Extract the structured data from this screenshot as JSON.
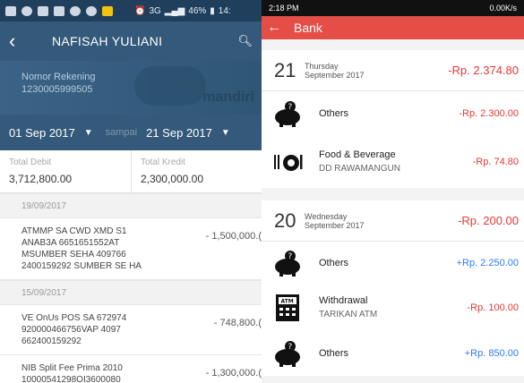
{
  "left": {
    "statusbar": {
      "signal": "3G",
      "battery": "46%",
      "time": "14:"
    },
    "header": {
      "title": "NAFISAH YULIANI"
    },
    "account": {
      "label": "Nomor Rekening",
      "number": "1230005999505",
      "watermark": "mandiri"
    },
    "date_range": {
      "from": "01 Sep 2017",
      "separator": "sampai",
      "to": "21 Sep 2017"
    },
    "totals": {
      "debit_label": "Total Debit",
      "debit_value": "3,712,800.00",
      "credit_label": "Total Kredit",
      "credit_value": "2,300,000.00"
    },
    "groups": [
      {
        "date": "19/09/2017",
        "items": [
          {
            "desc": "ATMMP SA CWD XMD S1 ANAB3A 6651651552AT MSUMBER SEHA 409766 2400159292 SUMBER SE HA",
            "amount": "- 1,500,000.("
          }
        ]
      },
      {
        "date": "15/09/2017",
        "items": [
          {
            "desc": "VE OnUs POS SA 672974 920000466756VAP 4097 662400159292",
            "amount": "- 748,800.("
          },
          {
            "desc": "NIB Split Fee Prima 2010 10000541298OI3600080",
            "amount": "- 1,300,000.("
          }
        ]
      }
    ]
  },
  "right": {
    "statusbar": {
      "time": "2:18 PM",
      "speed": "0.00K/s"
    },
    "header": {
      "title": "Bank"
    },
    "days": [
      {
        "day": "21",
        "weekday": "Thursday",
        "month": "September 2017",
        "total": "-Rp. 2.374.80",
        "items": [
          {
            "icon": "piggy-bank-question-icon",
            "label": "Others",
            "sub": "",
            "amount": "-Rp. 2.300.00",
            "sign": "neg"
          },
          {
            "icon": "food-beverage-icon",
            "label": "Food & Beverage",
            "sub": "DD RAWAMANGUN",
            "amount": "-Rp. 74.80",
            "sign": "neg"
          }
        ]
      },
      {
        "day": "20",
        "weekday": "Wednesday",
        "month": "September 2017",
        "total": "-Rp. 200.00",
        "items": [
          {
            "icon": "piggy-bank-question-icon",
            "label": "Others",
            "sub": "",
            "amount": "+Rp. 2.250.00",
            "sign": "pos"
          },
          {
            "icon": "atm-icon",
            "label": "Withdrawal",
            "sub": "TARIKAN ATM",
            "amount": "-Rp. 100.00",
            "sign": "neg"
          },
          {
            "icon": "piggy-bank-question-icon",
            "label": "Others",
            "sub": "",
            "amount": "+Rp. 850.00",
            "sign": "pos"
          }
        ]
      }
    ]
  }
}
